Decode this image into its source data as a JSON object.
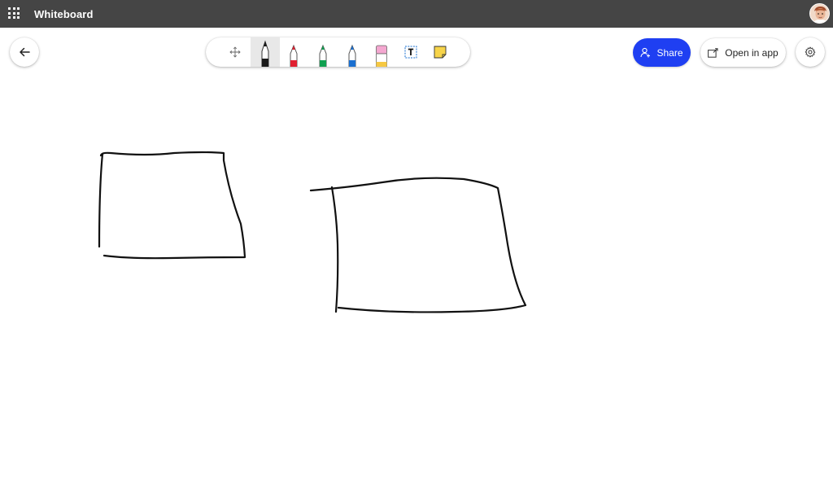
{
  "appbar": {
    "title": "Whiteboard"
  },
  "toolbar": {
    "tools": [
      {
        "name": "move",
        "icon": "move-icon"
      },
      {
        "name": "pen-black",
        "icon": "pen-icon",
        "color": "#1a1a1a",
        "selected": true
      },
      {
        "name": "pen-red",
        "icon": "pen-icon",
        "color": "#e02030"
      },
      {
        "name": "pen-green",
        "icon": "pen-icon",
        "color": "#10a050"
      },
      {
        "name": "pen-blue",
        "icon": "pen-icon",
        "color": "#1a6fd0"
      },
      {
        "name": "eraser",
        "icon": "eraser-icon",
        "color": "#f4a7d0"
      },
      {
        "name": "text",
        "icon": "text-box-icon"
      },
      {
        "name": "note",
        "icon": "sticky-note-icon",
        "color": "#f7d44a"
      }
    ]
  },
  "actions": {
    "share_label": "Share",
    "open_label": "Open in app"
  },
  "colors": {
    "appbar": "#454545",
    "share": "#1f3ff2",
    "ink": "#111111"
  }
}
